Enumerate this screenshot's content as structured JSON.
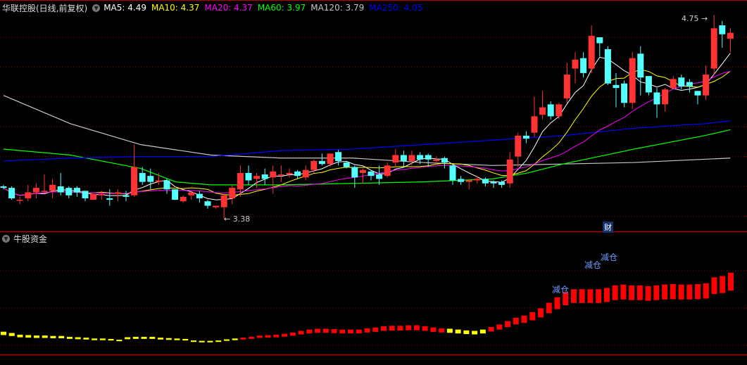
{
  "header": {
    "title": "华联控股(日线,前复权)",
    "ma": [
      {
        "label": "MA5: 4.49",
        "color": "#ffffff"
      },
      {
        "label": "MA10: 4.37",
        "color": "#ffff00"
      },
      {
        "label": "MA20: 4.37",
        "color": "#ff00ff"
      },
      {
        "label": "MA60: 3.97",
        "color": "#00ff00"
      },
      {
        "label": "MA120: 3.79",
        "color": "#c8c8c8"
      },
      {
        "label": "MA250: 4.05",
        "color": "#0000ff"
      }
    ]
  },
  "annotations": {
    "high": "4.75",
    "low": "3.38",
    "finance_marker": "财"
  },
  "indicator": {
    "title": "牛股资金",
    "signals": [
      "减仓",
      "减仓",
      "减仓"
    ]
  },
  "colors": {
    "up": "#ff3333",
    "down": "#54ffff",
    "grid": "#8b0000",
    "ind_up": "#ff0000",
    "ind_down": "#ffff00"
  },
  "chart_data": {
    "type": "candlestick",
    "candles": [
      [
        3.6,
        3.61,
        3.58,
        3.59
      ],
      [
        3.59,
        3.6,
        3.51,
        3.52
      ],
      [
        3.505,
        3.53,
        3.48,
        3.51
      ],
      [
        3.52,
        3.61,
        3.5,
        3.56
      ],
      [
        3.56,
        3.62,
        3.52,
        3.59
      ],
      [
        3.57,
        3.68,
        3.56,
        3.57
      ],
      [
        3.57,
        3.65,
        3.52,
        3.61
      ],
      [
        3.6,
        3.69,
        3.54,
        3.56
      ],
      [
        3.59,
        3.6,
        3.52,
        3.54
      ],
      [
        3.59,
        3.6,
        3.53,
        3.56
      ],
      [
        3.57,
        3.57,
        3.5,
        3.52
      ],
      [
        3.51,
        3.55,
        3.51,
        3.55
      ],
      [
        3.54,
        3.57,
        3.51,
        3.55
      ],
      [
        3.52,
        3.58,
        3.47,
        3.51
      ],
      [
        3.55,
        3.58,
        3.5,
        3.56
      ],
      [
        3.54,
        3.57,
        3.5,
        3.53
      ],
      [
        3.54,
        3.88,
        3.53,
        3.73
      ],
      [
        3.69,
        3.73,
        3.61,
        3.63
      ],
      [
        3.67,
        3.72,
        3.58,
        3.63
      ],
      [
        3.63,
        3.69,
        3.61,
        3.64
      ],
      [
        3.64,
        3.65,
        3.55,
        3.58
      ],
      [
        3.58,
        3.58,
        3.51,
        3.51
      ],
      [
        3.5,
        3.54,
        3.49,
        3.53
      ],
      [
        3.54,
        3.57,
        3.51,
        3.56
      ],
      [
        3.55,
        3.57,
        3.49,
        3.52
      ],
      [
        3.5,
        3.51,
        3.45,
        3.47
      ],
      [
        3.46,
        3.47,
        3.45,
        3.47
      ],
      [
        3.46,
        3.55,
        3.38,
        3.54
      ],
      [
        3.52,
        3.61,
        3.48,
        3.59
      ],
      [
        3.58,
        3.74,
        3.53,
        3.69
      ],
      [
        3.69,
        3.74,
        3.61,
        3.64
      ],
      [
        3.65,
        3.69,
        3.59,
        3.67
      ],
      [
        3.68,
        3.72,
        3.61,
        3.65
      ],
      [
        3.66,
        3.74,
        3.55,
        3.7
      ],
      [
        3.68,
        3.74,
        3.63,
        3.68
      ],
      [
        3.68,
        3.72,
        3.66,
        3.69
      ],
      [
        3.7,
        3.71,
        3.65,
        3.67
      ],
      [
        3.66,
        3.74,
        3.64,
        3.71
      ],
      [
        3.71,
        3.78,
        3.69,
        3.77
      ],
      [
        3.77,
        3.82,
        3.74,
        3.75
      ],
      [
        3.75,
        3.82,
        3.73,
        3.82
      ],
      [
        3.83,
        3.845,
        3.74,
        3.77
      ],
      [
        3.76,
        3.77,
        3.72,
        3.73
      ],
      [
        3.73,
        3.74,
        3.59,
        3.66
      ],
      [
        3.69,
        3.72,
        3.62,
        3.71
      ],
      [
        3.7,
        3.71,
        3.64,
        3.67
      ],
      [
        3.68,
        3.74,
        3.61,
        3.65
      ],
      [
        3.67,
        3.76,
        3.66,
        3.74
      ],
      [
        3.76,
        3.85,
        3.73,
        3.81
      ],
      [
        3.81,
        3.84,
        3.73,
        3.77
      ],
      [
        3.77,
        3.84,
        3.74,
        3.81
      ],
      [
        3.81,
        3.83,
        3.75,
        3.78
      ],
      [
        3.81,
        3.82,
        3.73,
        3.78
      ],
      [
        3.77,
        3.8,
        3.75,
        3.78
      ],
      [
        3.79,
        3.8,
        3.72,
        3.76
      ],
      [
        3.74,
        3.75,
        3.61,
        3.64
      ],
      [
        3.65,
        3.67,
        3.61,
        3.63
      ],
      [
        3.63,
        3.65,
        3.58,
        3.64
      ],
      [
        3.64,
        3.67,
        3.62,
        3.65
      ],
      [
        3.65,
        3.66,
        3.6,
        3.62
      ],
      [
        3.63,
        3.64,
        3.59,
        3.62
      ],
      [
        3.63,
        3.64,
        3.59,
        3.61
      ],
      [
        3.62,
        3.83,
        3.59,
        3.78
      ],
      [
        3.8,
        3.96,
        3.73,
        3.94
      ],
      [
        3.94,
        3.97,
        3.89,
        3.92
      ],
      [
        3.96,
        4.2,
        3.93,
        4.07
      ],
      [
        4.08,
        4.24,
        4.05,
        4.13
      ],
      [
        4.15,
        4.17,
        4.05,
        4.07
      ],
      [
        4.07,
        4.16,
        4.05,
        4.15
      ],
      [
        4.19,
        4.43,
        4.16,
        4.35
      ],
      [
        4.39,
        4.5,
        4.29,
        4.45
      ],
      [
        4.46,
        4.5,
        4.33,
        4.36
      ],
      [
        4.39,
        4.68,
        4.36,
        4.61
      ],
      [
        4.6,
        4.6,
        4.47,
        4.56
      ],
      [
        4.52,
        4.54,
        4.28,
        4.29
      ],
      [
        4.28,
        4.36,
        4.13,
        4.26
      ],
      [
        4.29,
        4.31,
        4.13,
        4.16
      ],
      [
        4.16,
        4.5,
        4.12,
        4.46
      ],
      [
        4.49,
        4.54,
        4.21,
        4.33
      ],
      [
        4.34,
        4.34,
        4.21,
        4.23
      ],
      [
        4.23,
        4.26,
        4.06,
        4.15
      ],
      [
        4.15,
        4.26,
        4.1,
        4.25
      ],
      [
        4.26,
        4.34,
        4.25,
        4.32
      ],
      [
        4.33,
        4.35,
        4.25,
        4.27
      ],
      [
        4.3,
        4.32,
        4.23,
        4.27
      ],
      [
        4.24,
        4.24,
        4.15,
        4.21
      ],
      [
        4.21,
        4.41,
        4.18,
        4.35
      ],
      [
        4.39,
        4.75,
        4.35,
        4.66
      ],
      [
        4.68,
        4.71,
        4.53,
        4.62
      ],
      [
        4.59,
        4.66,
        4.5,
        4.63
      ]
    ],
    "ma_long": {
      "MA120": [
        [
          0,
          4.21
        ],
        [
          8.2,
          4.02
        ],
        [
          16.8,
          3.88
        ],
        [
          25.4,
          3.81
        ],
        [
          34,
          3.79
        ],
        [
          42.7,
          3.79
        ],
        [
          51.3,
          3.76
        ],
        [
          59.9,
          3.74
        ],
        [
          68.5,
          3.75
        ],
        [
          77.2,
          3.76
        ],
        [
          89,
          3.79
        ]
      ],
      "MA60": [
        [
          0,
          3.85
        ],
        [
          8.2,
          3.81
        ],
        [
          16.8,
          3.72
        ],
        [
          21.1,
          3.63
        ],
        [
          25.4,
          3.61
        ],
        [
          34,
          3.61
        ],
        [
          42.7,
          3.62
        ],
        [
          51.3,
          3.63
        ],
        [
          59.9,
          3.65
        ],
        [
          64.2,
          3.69
        ],
        [
          68.5,
          3.75
        ],
        [
          77.2,
          3.85
        ],
        [
          85.8,
          3.94
        ],
        [
          89,
          3.98
        ]
      ],
      "MA250": [
        [
          0,
          3.77
        ],
        [
          8.2,
          3.79
        ],
        [
          16.8,
          3.8
        ],
        [
          25.4,
          3.8
        ],
        [
          34,
          3.84
        ],
        [
          42.7,
          3.85
        ],
        [
          51.3,
          3.88
        ],
        [
          59.9,
          3.91
        ],
        [
          68.5,
          3.94
        ],
        [
          77.2,
          3.99
        ],
        [
          85.8,
          4.02
        ],
        [
          89,
          4.04
        ]
      ]
    },
    "price_grid": [
      4.6,
      4.4,
      4.2,
      4.0,
      3.8,
      3.6,
      3.4
    ],
    "indicator_values": [
      3.2,
      2.9,
      2.5,
      2.4,
      2.3,
      2.3,
      2.2,
      2.2,
      2.0,
      1.9,
      1.8,
      1.6,
      1.6,
      1.5,
      1.3,
      1.9,
      2.0,
      2.0,
      2.0,
      1.8,
      1.7,
      1.6,
      1.5,
      1.1,
      1.0,
      1.0,
      1.1,
      1.4,
      1.6,
      1.8,
      2.0,
      2.3,
      2.4,
      2.5,
      2.7,
      3.0,
      3.4,
      3.7,
      3.9,
      3.9,
      3.8,
      3.7,
      3.7,
      3.7,
      4.0,
      4.2,
      4.5,
      4.6,
      4.6,
      4.7,
      4.7,
      4.5,
      4.2,
      4.0,
      3.9,
      3.7,
      3.5,
      3.4,
      3.7,
      4.3,
      4.9,
      5.7,
      6.5,
      7.0,
      7.8,
      8.7,
      10.0,
      11.3,
      12.5,
      13.2,
      13.2,
      13.2,
      13.2,
      13.5,
      14.1,
      14.3,
      14.1,
      14.1,
      13.9,
      14.1,
      14.3,
      14.4,
      14.3,
      14.3,
      14.4,
      14.6,
      16.0,
      16.3,
      17.1
    ],
    "indicator_colors": "29 yellow, 25 red, 5 yellow, 30 red",
    "indicator_grid": [
      0,
      10,
      20
    ]
  }
}
